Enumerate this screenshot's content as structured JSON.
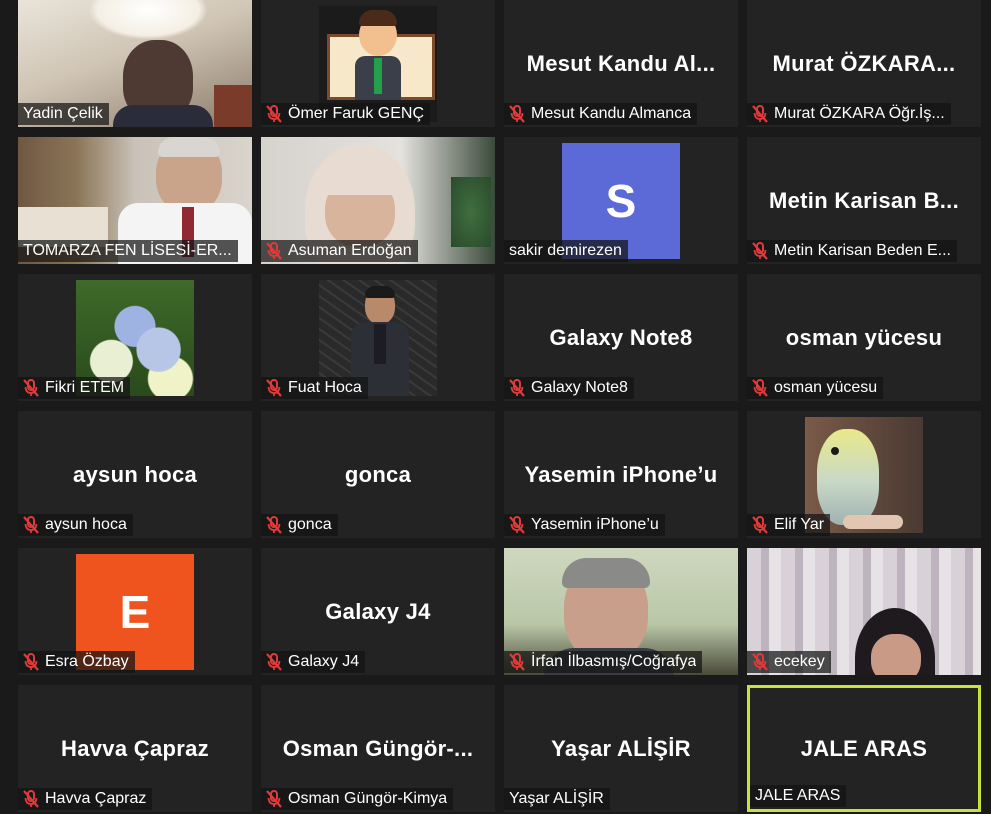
{
  "participants": [
    {
      "label": "Yadin Çelik",
      "muted": false,
      "display": "video",
      "scene": "man-office-light"
    },
    {
      "label": "Ömer Faruk GENÇ",
      "muted": true,
      "display": "picture",
      "scene": "cartoon-avatar"
    },
    {
      "label": "Mesut Kandu Almanca",
      "name_display": "Mesut Kandu Al...",
      "muted": true,
      "display": "name"
    },
    {
      "label": "Murat ÖZKARA Öğr.İş...",
      "name_display": "Murat ÖZKARA...",
      "muted": true,
      "display": "name"
    },
    {
      "label": "TOMARZA FEN LİSESİ-ER...",
      "muted": false,
      "display": "video",
      "scene": "man-suit-office"
    },
    {
      "label": "Asuman Erdoğan",
      "muted": true,
      "display": "video",
      "scene": "woman-headscarf"
    },
    {
      "label": "sakir demirezen",
      "muted": false,
      "display": "avatar",
      "initial": "S",
      "color": "#5b6ad6"
    },
    {
      "label": "Metin Karisan Beden E...",
      "name_display": "Metin Karisan B...",
      "muted": true,
      "display": "name"
    },
    {
      "label": "Fikri ETEM",
      "muted": true,
      "display": "picture",
      "scene": "hydrangea-flowers"
    },
    {
      "label": "Fuat Hoca",
      "muted": true,
      "display": "picture",
      "scene": "man-chalkboard"
    },
    {
      "label": "Galaxy Note8",
      "name_display": "Galaxy Note8",
      "muted": true,
      "display": "name"
    },
    {
      "label": "osman yücesu",
      "name_display": "osman yücesu",
      "muted": true,
      "display": "name"
    },
    {
      "label": "aysun hoca",
      "name_display": "aysun hoca",
      "muted": true,
      "display": "name"
    },
    {
      "label": "gonca",
      "name_display": "gonca",
      "muted": true,
      "display": "name"
    },
    {
      "label": "Yasemin iPhone’u",
      "name_display": "Yasemin iPhone’u",
      "muted": true,
      "display": "name"
    },
    {
      "label": "Elif Yar",
      "muted": true,
      "display": "picture",
      "scene": "budgie-bird"
    },
    {
      "label": "Esra Özbay",
      "muted": true,
      "display": "avatar",
      "initial": "E",
      "color": "#f0541e"
    },
    {
      "label": "Galaxy J4",
      "name_display": "Galaxy J4",
      "muted": true,
      "display": "name"
    },
    {
      "label": "İrfan İlbasmış/Coğrafya",
      "muted": true,
      "display": "video",
      "scene": "man-green-wall"
    },
    {
      "label": "ecekey",
      "muted": true,
      "display": "video",
      "scene": "girl-curtain"
    },
    {
      "label": "Havva Çapraz",
      "name_display": "Havva Çapraz",
      "muted": true,
      "display": "name"
    },
    {
      "label": "Osman Güngör-Kimya",
      "name_display": "Osman Güngör-...",
      "muted": true,
      "display": "name"
    },
    {
      "label": "Yaşar ALİŞİR",
      "name_display": "Yaşar ALİŞİR",
      "muted": false,
      "display": "name"
    },
    {
      "label": "JALE ARAS",
      "name_display": "JALE ARAS",
      "muted": false,
      "display": "name",
      "active_speaker": true
    }
  ],
  "colors": {
    "mute_icon": "#e03a3a",
    "active_border": "#c5e33b",
    "tile_bg": "#232323"
  }
}
